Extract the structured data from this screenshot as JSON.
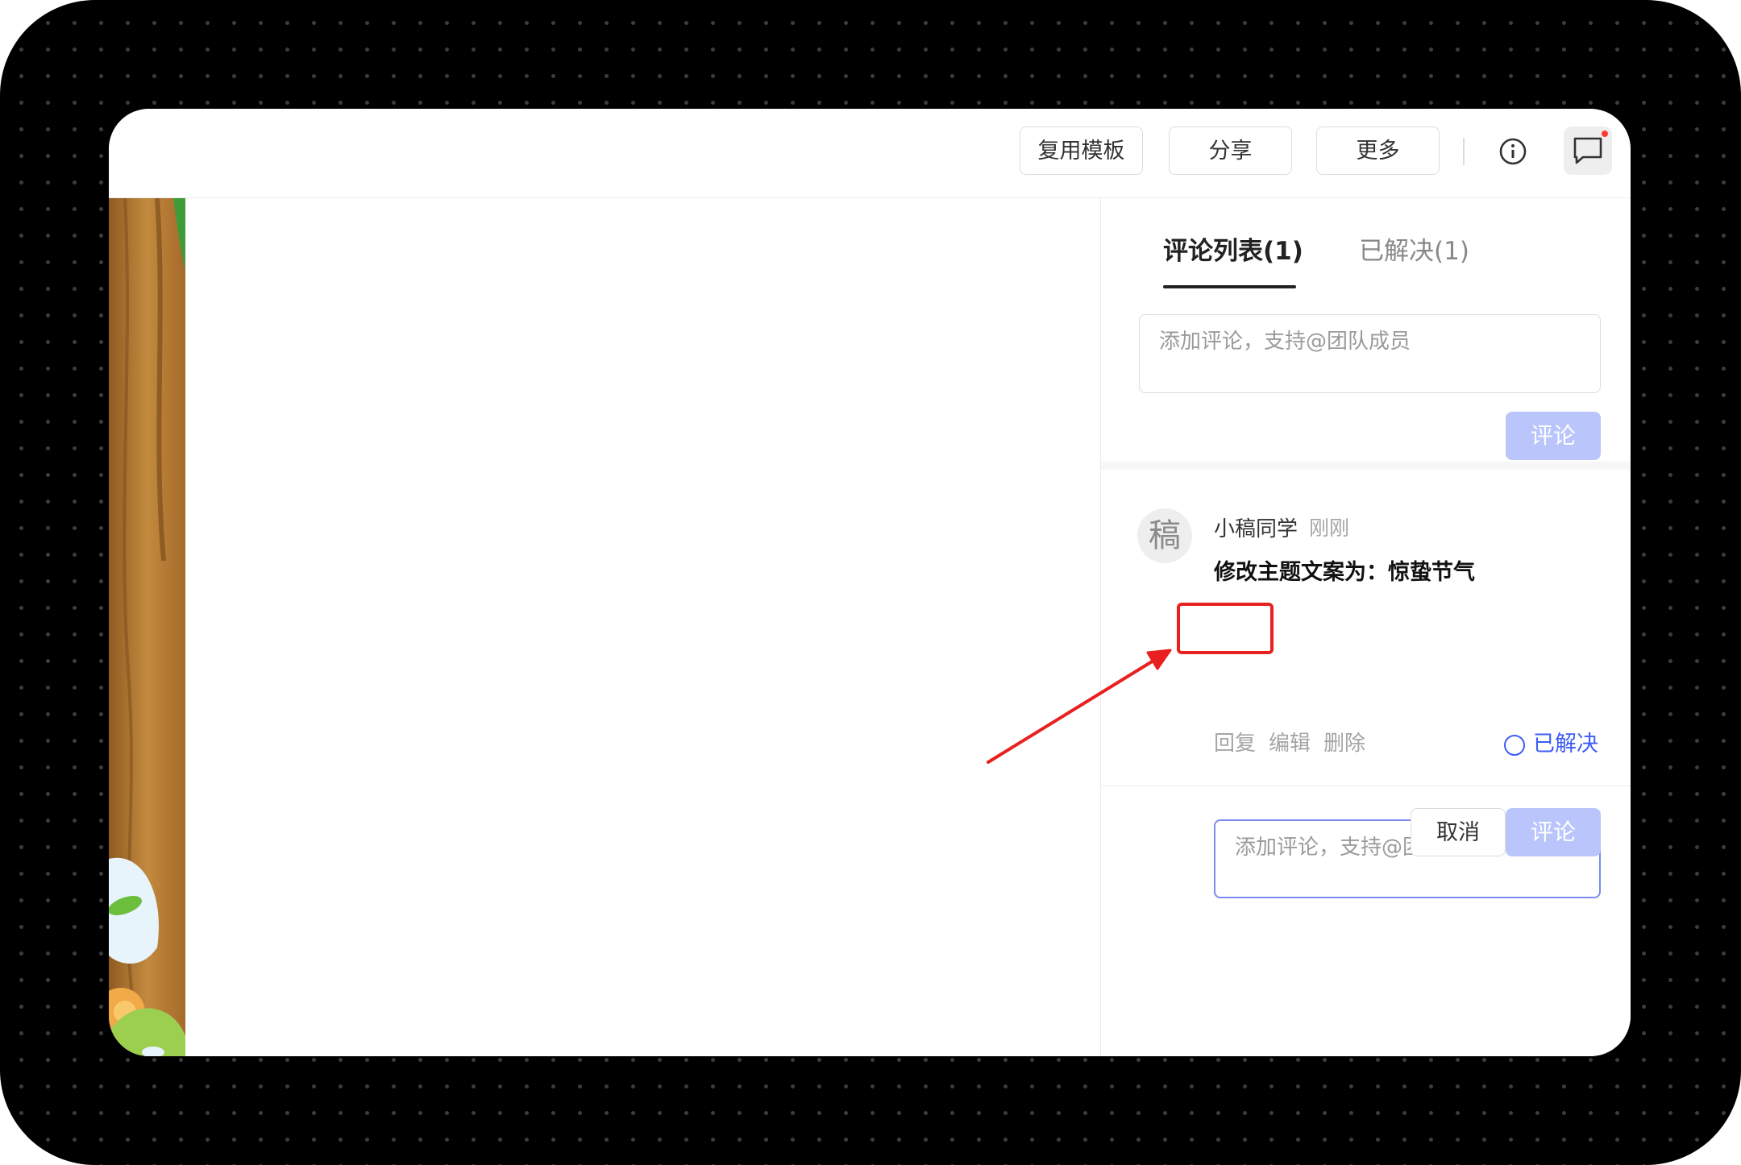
{
  "toolbar": {
    "reuse_template": "复用模板",
    "share": "分享",
    "more": "更多"
  },
  "comments_panel": {
    "tabs": [
      {
        "label": "评论列表(1)",
        "active": true
      },
      {
        "label": "已解决(1)",
        "active": false
      }
    ],
    "input_placeholder": "添加评论，支持@团队成员",
    "submit_label": "评论",
    "comment": {
      "avatar_char": "稿",
      "author": "小稿同学",
      "time": "刚刚",
      "text": "修改主题文案为：惊蛰节气",
      "actions": {
        "reply": "回复",
        "edit": "编辑",
        "delete": "删除"
      },
      "resolve_label": "已解决"
    },
    "reply_box": {
      "placeholder": "添加评论，支持@团队成员",
      "cancel_label": "取消",
      "submit_label": "评论"
    }
  },
  "colors": {
    "accent_blue": "#3d5cf5",
    "submit_disabled": "#b9c5fb",
    "annotation_red": "#e8201f"
  },
  "icons": [
    "info-icon",
    "comment-icon",
    "notification-dot"
  ]
}
